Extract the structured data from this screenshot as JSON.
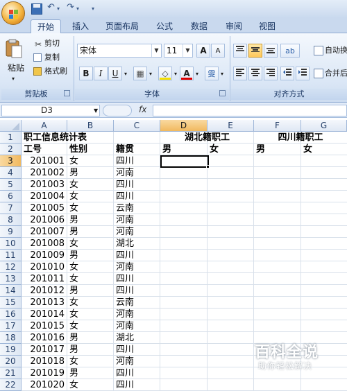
{
  "quick_access": {
    "undo_glyph": "↶",
    "redo_glyph": "↷",
    "customize_glyph": "▾"
  },
  "tabs": [
    "开始",
    "插入",
    "页面布局",
    "公式",
    "数据",
    "审阅",
    "视图"
  ],
  "ribbon": {
    "clipboard": {
      "paste": "粘贴",
      "cut": "剪切",
      "copy": "复制",
      "format_painter": "格式刷",
      "group_label": "剪贴板"
    },
    "font": {
      "font_name": "宋体",
      "font_size": "11",
      "grow": "A",
      "shrink": "A",
      "bold": "B",
      "italic": "I",
      "underline": "U",
      "border_glyph": "▦",
      "fill_glyph": "◇",
      "font_color_glyph": "A",
      "phonetic_glyph": "雯",
      "group_label": "字体"
    },
    "alignment": {
      "wrap_text": "自动换",
      "merge_center": "合并后",
      "group_label": "对齐方式"
    }
  },
  "formula_bar": {
    "name_box": "D3",
    "fx": "fx",
    "value": ""
  },
  "columns": [
    "A",
    "B",
    "C",
    "D",
    "E",
    "F",
    "G"
  ],
  "selected_column": "D",
  "rows": [
    {
      "n": "1",
      "a": "职工信息统计表",
      "b": "",
      "c": "",
      "d": "湖北籍职工",
      "e": "",
      "f": "四川籍职工",
      "g": ""
    },
    {
      "n": "2",
      "a": "工号",
      "b": "性别",
      "c": "籍贯",
      "d": "男",
      "e": "女",
      "f": "男",
      "g": "女"
    },
    {
      "n": "3",
      "a": "201001",
      "b": "女",
      "c": "四川"
    },
    {
      "n": "4",
      "a": "201002",
      "b": "男",
      "c": "河南"
    },
    {
      "n": "5",
      "a": "201003",
      "b": "女",
      "c": "四川"
    },
    {
      "n": "6",
      "a": "201004",
      "b": "女",
      "c": "四川"
    },
    {
      "n": "7",
      "a": "201005",
      "b": "女",
      "c": "云南"
    },
    {
      "n": "8",
      "a": "201006",
      "b": "男",
      "c": "河南"
    },
    {
      "n": "9",
      "a": "201007",
      "b": "男",
      "c": "河南"
    },
    {
      "n": "10",
      "a": "201008",
      "b": "女",
      "c": "湖北"
    },
    {
      "n": "11",
      "a": "201009",
      "b": "男",
      "c": "四川"
    },
    {
      "n": "12",
      "a": "201010",
      "b": "女",
      "c": "河南"
    },
    {
      "n": "13",
      "a": "201011",
      "b": "女",
      "c": "四川"
    },
    {
      "n": "14",
      "a": "201012",
      "b": "男",
      "c": "四川"
    },
    {
      "n": "15",
      "a": "201013",
      "b": "女",
      "c": "云南"
    },
    {
      "n": "16",
      "a": "201014",
      "b": "女",
      "c": "河南"
    },
    {
      "n": "17",
      "a": "201015",
      "b": "女",
      "c": "河南"
    },
    {
      "n": "18",
      "a": "201016",
      "b": "男",
      "c": "湖北"
    },
    {
      "n": "19",
      "a": "201017",
      "b": "男",
      "c": "四川"
    },
    {
      "n": "20",
      "a": "201018",
      "b": "女",
      "c": "河南"
    },
    {
      "n": "21",
      "a": "201019",
      "b": "男",
      "c": "四川"
    },
    {
      "n": "22",
      "a": "201020",
      "b": "女",
      "c": "四川"
    }
  ],
  "selected_row": "3",
  "watermark": {
    "title": "百科全说",
    "subtitle": "助你轻松解决"
  },
  "colors": {
    "ribbon": "#dbe7f6",
    "selection_header": "#f1b95f",
    "header_text": "#27416a"
  }
}
